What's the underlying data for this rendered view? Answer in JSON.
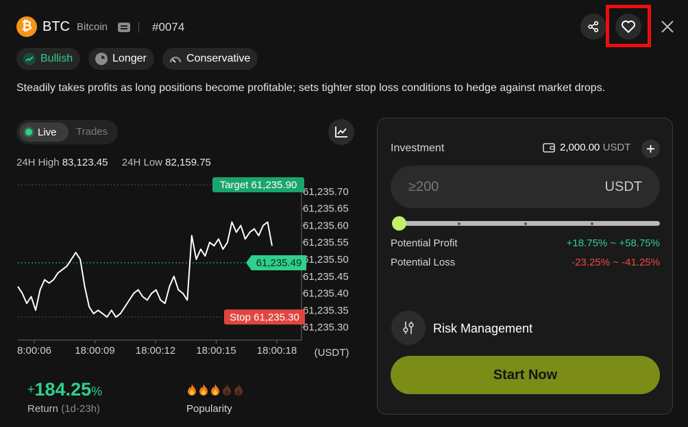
{
  "header": {
    "coin_symbol": "BTC",
    "coin_icon": "bitcoin-icon",
    "coin_name": "Bitcoin",
    "strategy_id": "#0074"
  },
  "tags": [
    {
      "label": "Bullish",
      "icon": "trend-up-icon"
    },
    {
      "label": "Longer",
      "icon": "clock-icon"
    },
    {
      "label": "Conservative",
      "icon": "gauge-icon"
    }
  ],
  "description": "Steadily takes profits as long positions become profitable; sets tighter stop loss conditions to hedge against market drops.",
  "chart_tabs": {
    "live": "Live",
    "trades": "Trades",
    "active": "Live"
  },
  "stats": {
    "high_label": "24H High",
    "high_value": "83,123.45",
    "low_label": "24H Low",
    "low_value": "82,159.75"
  },
  "chart_data": {
    "type": "line",
    "x_ticks": [
      "8:00:06",
      "18:00:09",
      "18:00:12",
      "18:00:15",
      "18:00:18"
    ],
    "y_ticks": [
      "61,235.70",
      "61,235.65",
      "61,235.60",
      "61,235.55",
      "61,235.50",
      "61,235.45",
      "61,235.40",
      "61,235.35",
      "61,235.30"
    ],
    "ylim": [
      61235.27,
      61235.72
    ],
    "unit": "(USDT)",
    "target_label": "Target 61,235.90",
    "stop_label": "Stop 61,235.30",
    "current_label": "61,235.49",
    "target_level": 61235.72,
    "current_level": 61235.49,
    "stop_level": 61235.33,
    "colors": {
      "line": "#ffffff",
      "target": "#1aa56e",
      "current": "#2ed08b",
      "stop": "#e0463f"
    },
    "series": [
      {
        "values": [
          61235.42,
          61235.4,
          61235.37,
          61235.39,
          61235.35,
          61235.41,
          61235.44,
          61235.43,
          61235.44,
          61235.46,
          61235.47,
          61235.48,
          61235.5,
          61235.52,
          61235.5,
          61235.42,
          61235.36,
          61235.34,
          61235.35,
          61235.34,
          61235.33,
          61235.35,
          61235.33,
          61235.34,
          61235.36,
          61235.38,
          61235.4,
          61235.41,
          61235.39,
          61235.38,
          61235.4,
          61235.41,
          61235.38,
          61235.37,
          61235.42,
          61235.45,
          61235.41,
          61235.4,
          61235.38,
          61235.57,
          61235.5,
          61235.53,
          61235.51,
          61235.55,
          61235.54,
          61235.56,
          61235.53,
          61235.55,
          61235.61,
          61235.58,
          61235.6,
          61235.56,
          61235.58,
          61235.59,
          61235.57,
          61235.6,
          61235.61,
          61235.54
        ]
      }
    ]
  },
  "summary": {
    "return_value": "184.25",
    "return_prefix": "+",
    "return_suffix": "%",
    "return_label": "Return",
    "return_period": "(1d-23h)",
    "popularity_label": "Popularity",
    "popularity_level": 3,
    "popularity_max": 5
  },
  "panel": {
    "investment_label": "Investment",
    "balance_value": "2,000.00",
    "balance_unit": "USDT",
    "input_placeholder": "≥200",
    "input_currency": "USDT",
    "slider_value": 0,
    "profit_label": "Potential Profit",
    "profit_value": "+18.75% ~ +58.75%",
    "loss_label": "Potential Loss",
    "loss_value": "-23.25% ~ -41.25%",
    "risk_label": "Risk Management",
    "start_label": "Start Now"
  }
}
